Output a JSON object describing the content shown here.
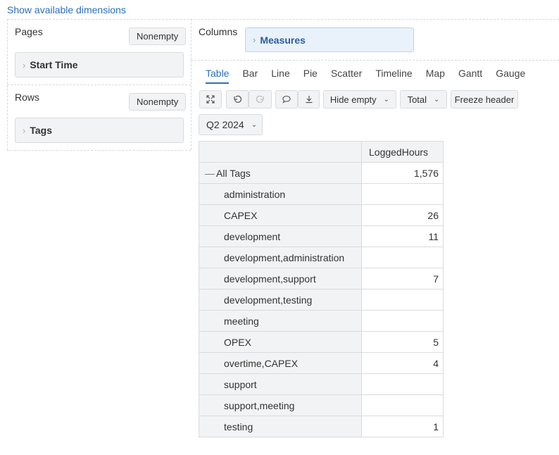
{
  "show_dims_label": "Show available dimensions",
  "pages": {
    "title": "Pages",
    "nonempty": "Nonempty",
    "dimension": "Start Time"
  },
  "rows": {
    "title": "Rows",
    "nonempty": "Nonempty",
    "dimension": "Tags"
  },
  "columns": {
    "title": "Columns",
    "dimension": "Measures"
  },
  "tabs": [
    "Table",
    "Bar",
    "Line",
    "Pie",
    "Scatter",
    "Timeline",
    "Map",
    "Gantt",
    "Gauge"
  ],
  "toolbar": {
    "icons": [
      "fullscreen-icon",
      "undo-icon",
      "redo-icon",
      "comment-icon",
      "export-icon"
    ],
    "hide_empty": "Hide empty",
    "total": "Total",
    "freeze_header": "Freeze header"
  },
  "period": "Q2 2024",
  "table": {
    "column_header": "LoggedHours",
    "total_row": {
      "label": "All Tags",
      "value": "1,576"
    },
    "rows": [
      {
        "label": "administration",
        "value": ""
      },
      {
        "label": "CAPEX",
        "value": "26"
      },
      {
        "label": "development",
        "value": "11"
      },
      {
        "label": "development,administration",
        "value": ""
      },
      {
        "label": "development,support",
        "value": "7"
      },
      {
        "label": "development,testing",
        "value": ""
      },
      {
        "label": "meeting",
        "value": ""
      },
      {
        "label": "OPEX",
        "value": "5"
      },
      {
        "label": "overtime,CAPEX",
        "value": "4"
      },
      {
        "label": "support",
        "value": ""
      },
      {
        "label": "support,meeting",
        "value": ""
      },
      {
        "label": "testing",
        "value": "1"
      }
    ]
  }
}
